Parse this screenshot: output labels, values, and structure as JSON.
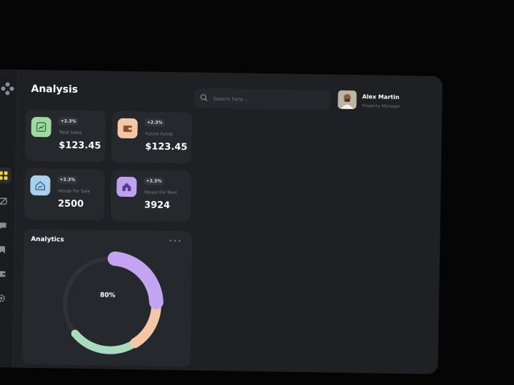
{
  "header": {
    "title": "Analysis"
  },
  "search": {
    "placeholder": "Search here...."
  },
  "user": {
    "name": "Alex Martin",
    "role": "Property Manager"
  },
  "stats": [
    {
      "label": "Total Sales",
      "badge": "+2.3%",
      "value": "$123.45",
      "icon": "chart-icon",
      "color": "#9fd8a1"
    },
    {
      "label": "Future Funds",
      "badge": "+2.3%",
      "value": "$123.45",
      "icon": "wallet-icon",
      "color": "#f3c6a6"
    },
    {
      "label": "House For Sale",
      "badge": "+2.3%",
      "value": "2500",
      "icon": "house-trend-icon",
      "color": "#a9d1ef"
    },
    {
      "label": "House For Rent",
      "badge": "+2.3%",
      "value": "3924",
      "icon": "house-icon",
      "color": "#bfa2ee"
    }
  ],
  "analytics": {
    "title": "Analytics",
    "more": "•••",
    "percent_label": "80%",
    "percent": 80,
    "segment_colors": [
      "#c3a4f2",
      "#f3c6a6",
      "#a8dcc0"
    ],
    "track_color": "#2f3236"
  },
  "sidebar": {
    "icons": [
      "grid-icon",
      "camera-off-icon",
      "chat-icon",
      "bookmark-icon",
      "wallet-icon",
      "gear-icon"
    ],
    "active_color": "#f5d73a"
  }
}
